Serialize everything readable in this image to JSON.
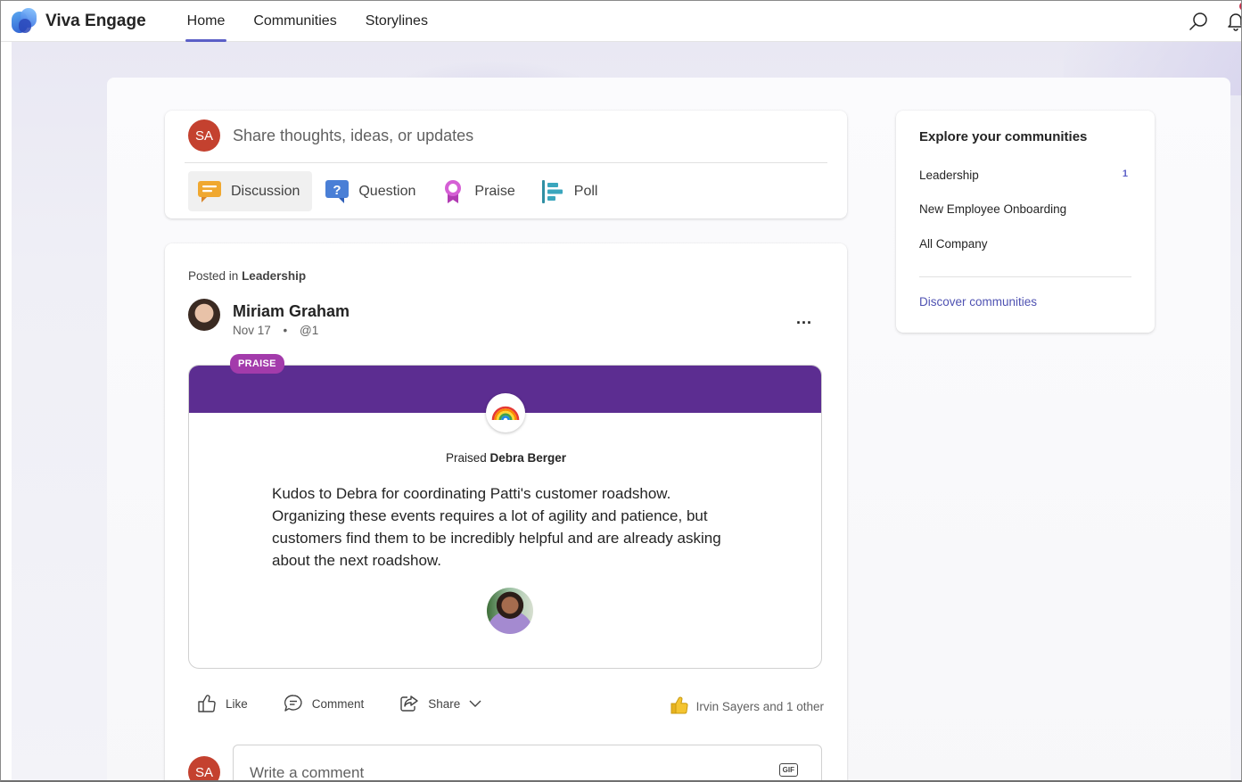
{
  "app": {
    "name": "Viva Engage"
  },
  "nav": {
    "items": [
      {
        "label": "Home"
      },
      {
        "label": "Communities"
      },
      {
        "label": "Storylines"
      }
    ]
  },
  "user": {
    "initials": "SA"
  },
  "composer": {
    "placeholder": "Share thoughts, ideas, or updates",
    "actions": [
      {
        "label": "Discussion",
        "icon": "discussion-icon",
        "color": "#e8a33a"
      },
      {
        "label": "Question",
        "icon": "question-icon",
        "color": "#4a7fd6"
      },
      {
        "label": "Praise",
        "icon": "praise-icon",
        "color": "#c43bc4"
      },
      {
        "label": "Poll",
        "icon": "poll-icon",
        "color": "#2f8fa3"
      }
    ]
  },
  "post": {
    "posted_in_prefix": "Posted in",
    "community": "Leadership",
    "author": "Miriam Graham",
    "date": "Nov 17",
    "separator": "•",
    "seen_count": "@1",
    "more": "...",
    "praise": {
      "tag": "PRAISE",
      "header_color": "#5c2d91",
      "praised_prefix": "Praised",
      "praised_name": "Debra Berger",
      "badge_icon": "rainbow-icon",
      "message": "Kudos to Debra for coordinating Patti's customer roadshow. Organizing these events requires a lot of agility and patience, but customers find them to be incredibly helpful and are already asking about the next roadshow."
    },
    "actions": {
      "like": "Like",
      "comment": "Comment",
      "share": "Share"
    },
    "reactions_text": "Irvin Sayers and 1 other",
    "comment_placeholder": "Write a comment",
    "gif_label": "GIF"
  },
  "sidebar": {
    "title": "Explore your communities",
    "communities": [
      {
        "name": "Leadership",
        "count": "1"
      },
      {
        "name": "New Employee Onboarding",
        "count": ""
      },
      {
        "name": "All Company",
        "count": ""
      }
    ],
    "discover": "Discover communities"
  },
  "colors": {
    "accent": "#5b5fc7",
    "avatar": "#c4412f",
    "praise_tag": "#a33bab"
  }
}
